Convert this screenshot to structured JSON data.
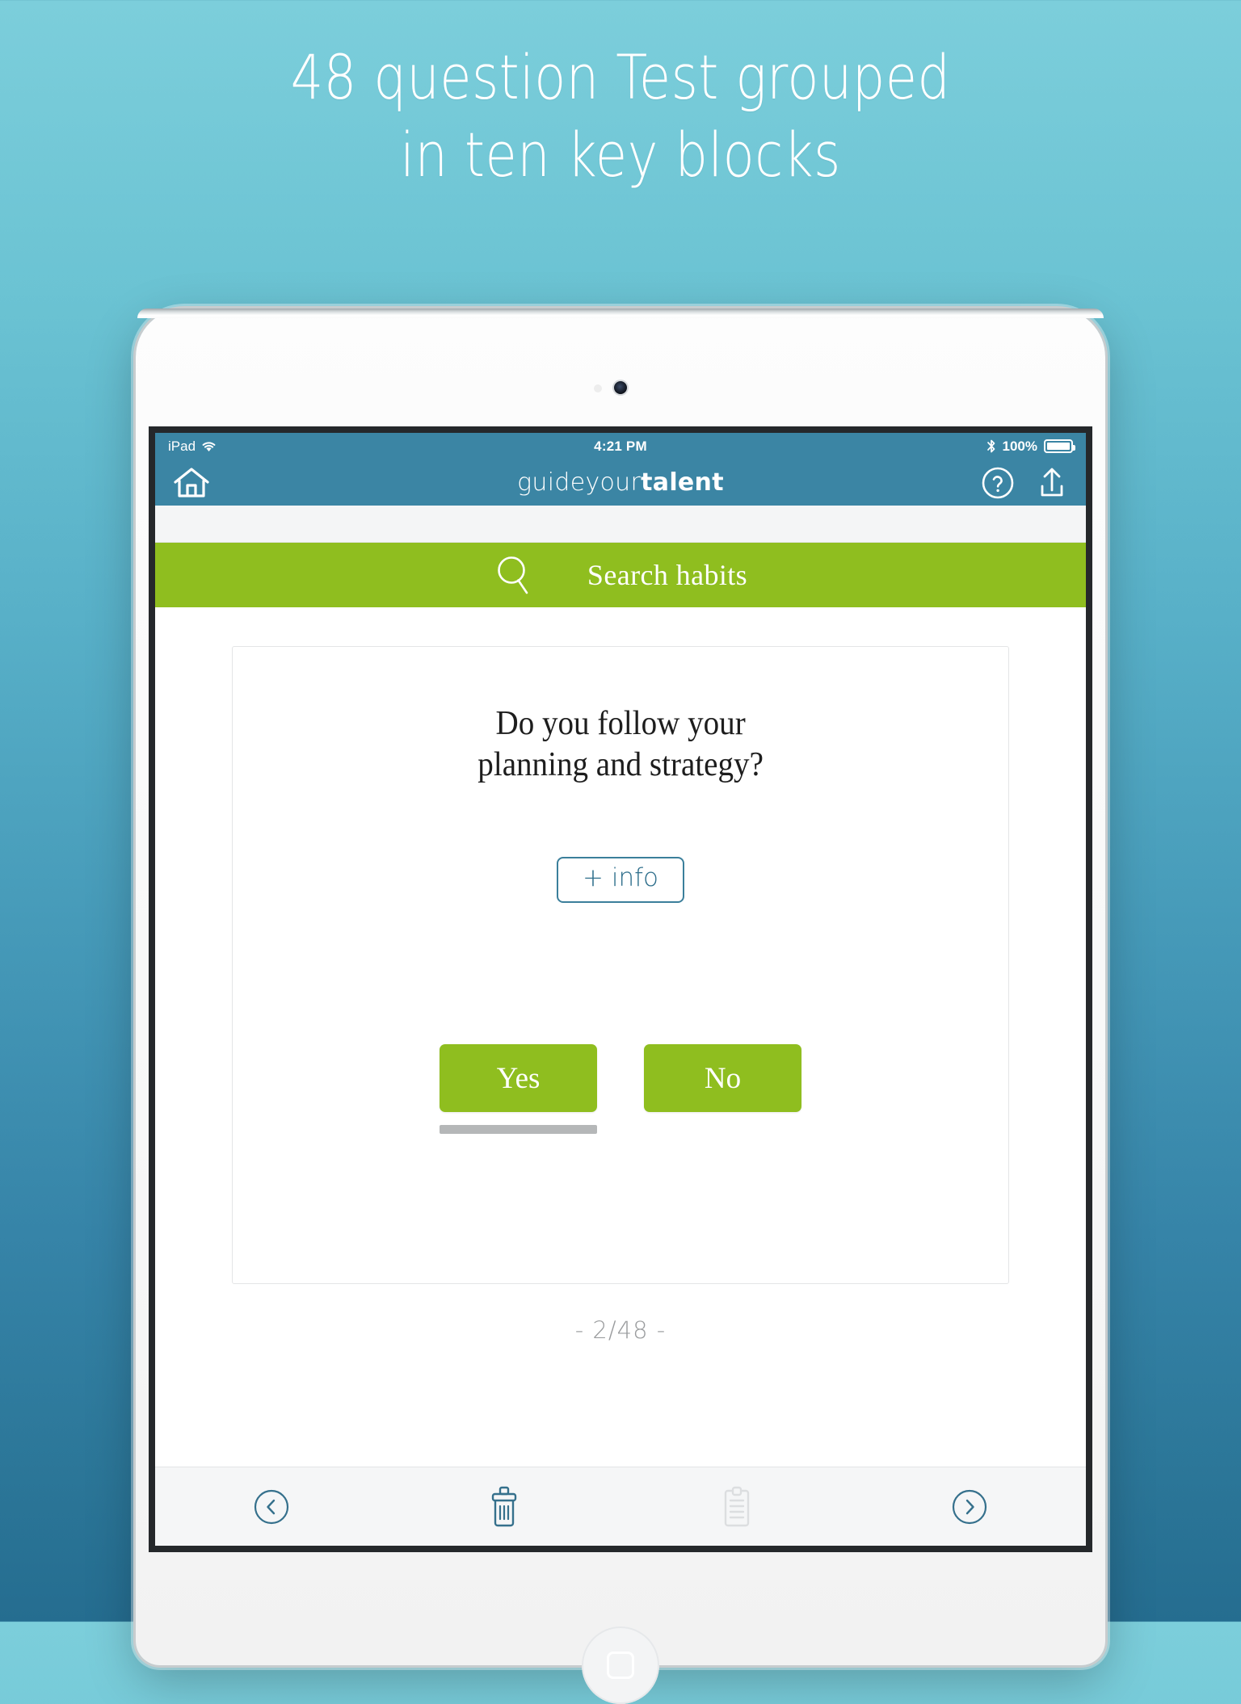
{
  "promo": {
    "headline_line1": "48 question Test grouped",
    "headline_line2": "in ten key blocks"
  },
  "device": {
    "type": "tablet",
    "camera": "front-camera",
    "home_button": "home-button"
  },
  "statusbar": {
    "carrier": "iPad",
    "wifi_icon": "wifi-icon",
    "time": "4:21 PM",
    "bluetooth_icon": "bluetooth-icon",
    "battery_percent": "100%",
    "battery_icon": "battery-full-icon"
  },
  "navbar": {
    "home_icon": "home-icon",
    "logo_light": "guideyour",
    "logo_bold": "talent",
    "help_icon": "help-circle-icon",
    "share_icon": "share-upload-icon"
  },
  "search": {
    "icon": "search-icon",
    "label": "Search habits"
  },
  "question_card": {
    "question_line1": "Do you follow your",
    "question_line2": "planning and strategy?",
    "info_button": "+ info",
    "answers": [
      {
        "label": "Yes",
        "selected": true
      },
      {
        "label": "No",
        "selected": false
      }
    ]
  },
  "counter": "- 2/48 -",
  "tabbar": {
    "items": [
      {
        "name": "previous-button",
        "icon": "chevron-left-circle-icon",
        "enabled": true
      },
      {
        "name": "delete-button",
        "icon": "trash-icon",
        "enabled": true
      },
      {
        "name": "report-button",
        "icon": "clipboard-icon",
        "enabled": false
      },
      {
        "name": "next-button",
        "icon": "chevron-right-circle-icon",
        "enabled": true
      }
    ]
  },
  "colors": {
    "background_top": "#7ccedb",
    "background_bottom": "#256d90",
    "nav_blue": "#3b85a4",
    "accent_green": "#8fbe1f",
    "teal_icon": "#35708c",
    "disabled_gray": "#dcdee0",
    "selection_gray": "#b5b7b8"
  }
}
